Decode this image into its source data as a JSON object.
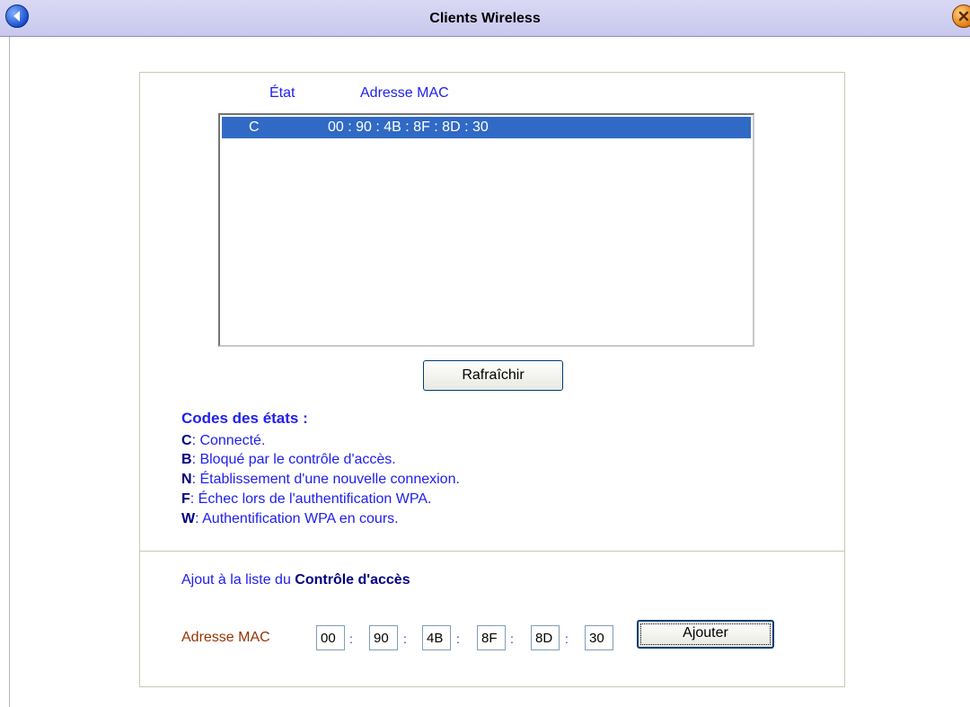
{
  "window": {
    "title": "Clients Wireless",
    "back_icon": "back-arrow-icon",
    "close_icon": "close-icon"
  },
  "table": {
    "headers": [
      "État",
      "Adresse MAC"
    ],
    "rows": [
      {
        "state": "C",
        "mac": "00 : 90 : 4B : 8F : 8D : 30",
        "selected": true
      }
    ]
  },
  "refresh_button": "Rafraîchir",
  "legend": {
    "title": "Codes des états :",
    "items": [
      {
        "code": "C",
        "text": ": Connecté."
      },
      {
        "code": "B",
        "text": ": Bloqué par le contrôle d'accès."
      },
      {
        "code": "N",
        "text": ": Établissement d'une nouvelle connexion."
      },
      {
        "code": "F",
        "text": ": Échec lors de l'authentification WPA."
      },
      {
        "code": "W",
        "text": ": Authentification WPA en cours."
      }
    ]
  },
  "add_section": {
    "prefix": "Ajout à la liste du ",
    "emphasis": "Contrôle d'accès",
    "mac_label": "Adresse MAC",
    "octets": [
      "00",
      "90",
      "4B",
      "8F",
      "8D",
      "30"
    ],
    "separator": ":",
    "add_button": "Ajouter"
  },
  "colors": {
    "title_bar": "#d0d0f0",
    "selection": "#316ac5",
    "link_blue": "#2020ee",
    "label_brown": "#993300"
  }
}
